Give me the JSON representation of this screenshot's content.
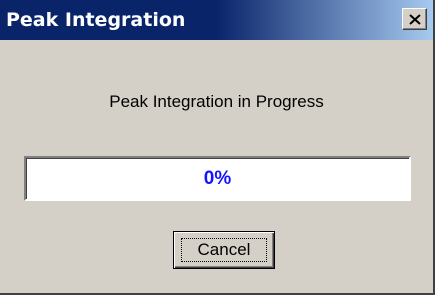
{
  "window": {
    "title": "Peak Integration"
  },
  "titlebar": {
    "close_icon": "close-x"
  },
  "message": "Peak Integration in Progress",
  "progress": {
    "value": 0,
    "label": "0%",
    "text_color": "#1414ff"
  },
  "buttons": {
    "cancel_label": "Cancel"
  }
}
